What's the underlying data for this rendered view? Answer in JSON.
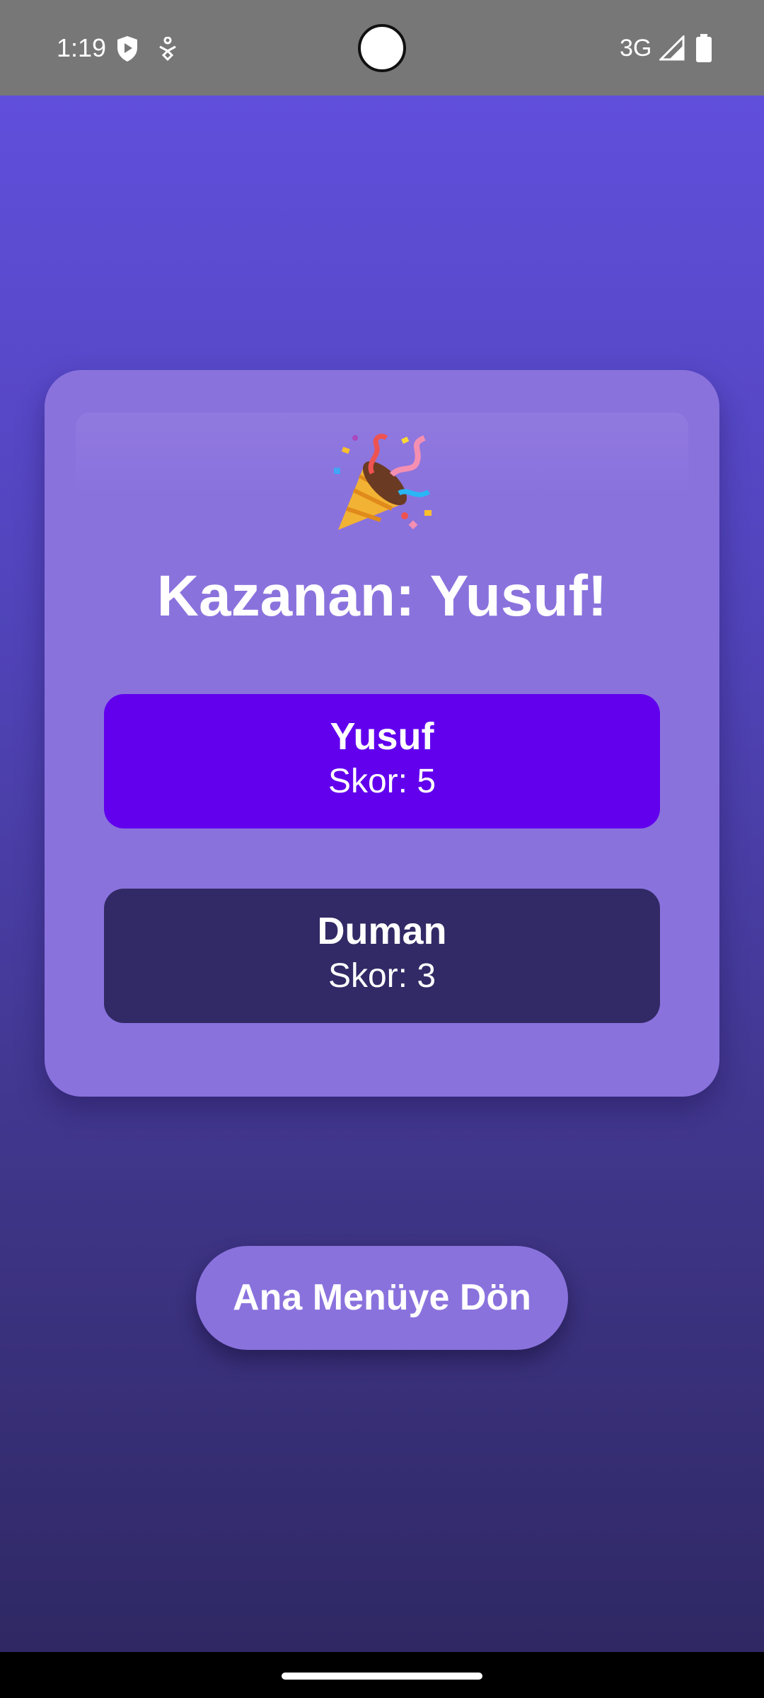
{
  "status_bar": {
    "time": "1:19",
    "network": "3G",
    "icons": [
      "shield-icon",
      "accessibility-icon",
      "signal-icon",
      "battery-icon"
    ]
  },
  "result": {
    "title": "Kazanan: Yusuf!",
    "icon": "party-popper-icon",
    "players": [
      {
        "name": "Yusuf",
        "score": "Skor: 5",
        "highlight_color": "#6200ee"
      },
      {
        "name": "Duman",
        "score": "Skor: 3",
        "highlight_color": "#322a66"
      }
    ]
  },
  "actions": {
    "main_menu_label": "Ana Menüye Dön"
  },
  "colors": {
    "background_top": "#604fdb",
    "background_bottom": "#2f2864",
    "card": "#8a72dd",
    "winner": "#6200ee",
    "runner_up": "#322a66",
    "text": "#ffffff"
  }
}
